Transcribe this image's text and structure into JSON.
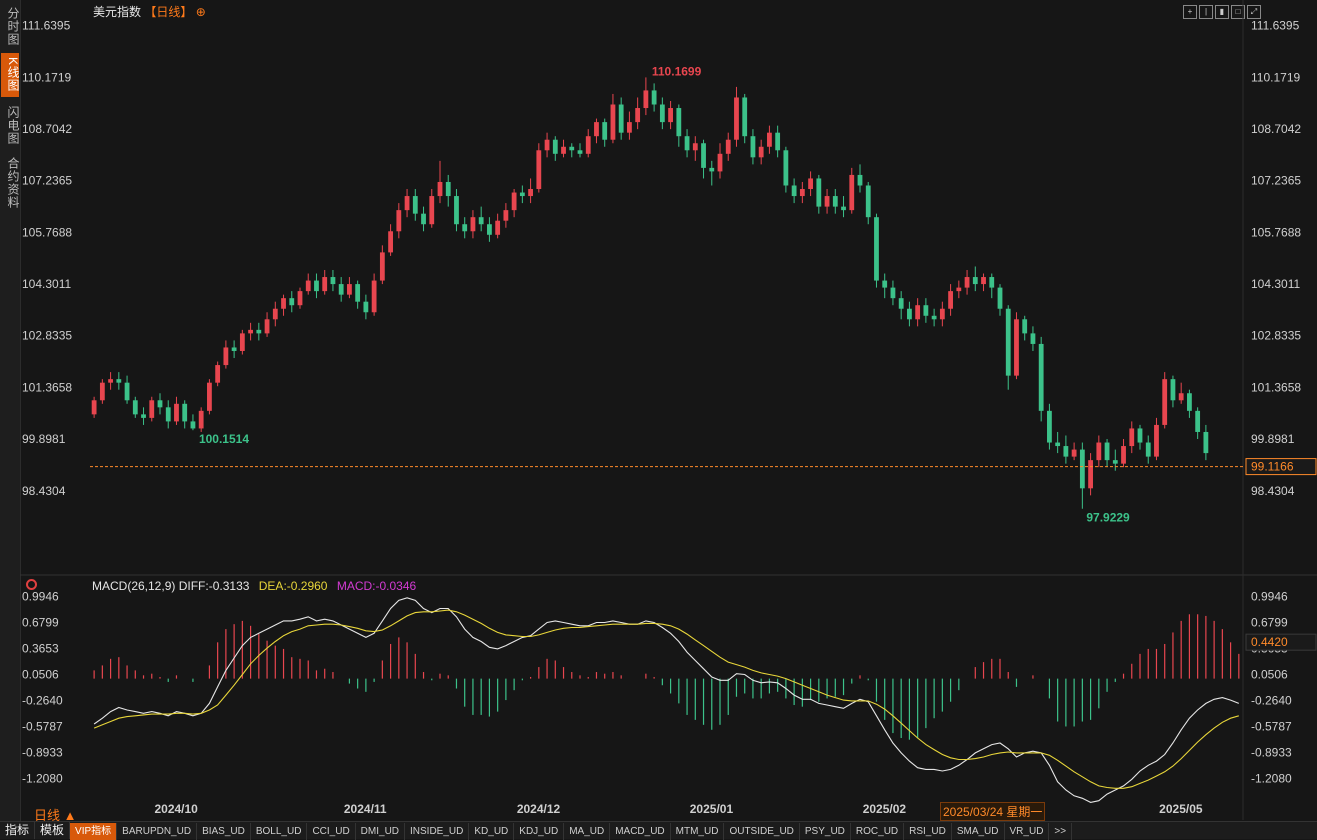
{
  "sidebar": {
    "tabs": [
      {
        "label": "分时图",
        "active": false
      },
      {
        "label": "K线图",
        "active": true
      },
      {
        "label": "闪电图",
        "active": false
      },
      {
        "label": "合约资料",
        "active": false
      }
    ]
  },
  "header": {
    "title": "美元指数",
    "period": "【日线】",
    "add_icon": "⊕",
    "toolbar_icons": [
      "crosshair-icon",
      "bars-icon",
      "candles-icon",
      "maximize-icon",
      "expand-icon"
    ]
  },
  "colors": {
    "up": "#e8464f",
    "down": "#3cc28a",
    "diff": "#e6e6e6",
    "dea": "#e8d63a",
    "macd": "#d33bd3",
    "accent": "#ff7a1a"
  },
  "price_axis": {
    "labels": [
      "111.6395",
      "110.1719",
      "108.7042",
      "107.2365",
      "105.7688",
      "104.3011",
      "102.8335",
      "101.3658",
      "99.8981",
      "98.4304"
    ]
  },
  "current_price": "99.1166",
  "annotations": {
    "high": "110.1699",
    "low_1": "100.1514",
    "low_2": "97.9229"
  },
  "macd": {
    "legend": {
      "name": "MACD(26,12,9)",
      "diff": "DIFF:-0.3133",
      "dea": "DEA:-0.2960",
      "macd": "MACD:-0.0346"
    },
    "axis_labels": [
      "0.9946",
      "0.6799",
      "0.3653",
      "0.0506",
      "-0.2640",
      "-0.5787",
      "-0.8933",
      "-1.2080"
    ],
    "cursor_value": "0.4420"
  },
  "date_axis": {
    "labels": [
      "2024/10",
      "2024/11",
      "2024/12",
      "2025/01",
      "2025/02",
      "2025/03",
      "2025/05"
    ],
    "cursor": "2025/03/24 星期一"
  },
  "period_select": "日线 ▲",
  "bottom_tabs": [
    "指标",
    "模板",
    "VIP指标",
    "BARUPDN_UD",
    "BIAS_UD",
    "BOLL_UD",
    "CCI_UD",
    "DMI_UD",
    "INSIDE_UD",
    "KD_UD",
    "KDJ_UD",
    "MA_UD",
    "MACD_UD",
    "MTM_UD",
    "OUTSIDE_UD",
    "PSY_UD",
    "ROC_UD",
    "RSI_UD",
    "SMA_UD",
    "VR_UD",
    ">>"
  ],
  "chart_data": {
    "type": "candlestick",
    "title": "美元指数",
    "ylim": [
      97.6,
      111.8
    ],
    "candles": [
      [
        100.6,
        101.0,
        101.1,
        100.5
      ],
      [
        101.0,
        101.5,
        101.6,
        100.9
      ],
      [
        101.5,
        101.6,
        101.8,
        101.3
      ],
      [
        101.6,
        101.5,
        101.8,
        101.3
      ],
      [
        101.5,
        101.0,
        101.7,
        100.9
      ],
      [
        101.0,
        100.6,
        101.1,
        100.5
      ],
      [
        100.6,
        100.5,
        100.8,
        100.3
      ],
      [
        100.5,
        101.0,
        101.1,
        100.4
      ],
      [
        101.0,
        100.8,
        101.2,
        100.6
      ],
      [
        100.8,
        100.4,
        101.0,
        100.2
      ],
      [
        100.4,
        100.9,
        101.1,
        100.3
      ],
      [
        100.9,
        100.4,
        101.0,
        100.2
      ],
      [
        100.4,
        100.2,
        100.6,
        100.15
      ],
      [
        100.2,
        100.7,
        100.8,
        100.1
      ],
      [
        100.7,
        101.5,
        101.6,
        100.6
      ],
      [
        101.5,
        102.0,
        102.1,
        101.4
      ],
      [
        102.0,
        102.5,
        102.7,
        101.9
      ],
      [
        102.5,
        102.4,
        102.7,
        102.2
      ],
      [
        102.4,
        102.9,
        103.0,
        102.3
      ],
      [
        102.9,
        103.0,
        103.2,
        102.7
      ],
      [
        103.0,
        102.9,
        103.2,
        102.7
      ],
      [
        102.9,
        103.3,
        103.5,
        102.8
      ],
      [
        103.3,
        103.6,
        103.8,
        103.1
      ],
      [
        103.6,
        103.9,
        104.0,
        103.4
      ],
      [
        103.9,
        103.7,
        104.1,
        103.5
      ],
      [
        103.7,
        104.1,
        104.2,
        103.6
      ],
      [
        104.1,
        104.4,
        104.6,
        104.0
      ],
      [
        104.4,
        104.1,
        104.6,
        103.9
      ],
      [
        104.1,
        104.5,
        104.7,
        104.0
      ],
      [
        104.5,
        104.3,
        104.7,
        104.1
      ],
      [
        104.3,
        104.0,
        104.5,
        103.8
      ],
      [
        104.0,
        104.3,
        104.5,
        103.9
      ],
      [
        104.3,
        103.8,
        104.4,
        103.6
      ],
      [
        103.8,
        103.5,
        104.0,
        103.3
      ],
      [
        103.5,
        104.4,
        104.6,
        103.4
      ],
      [
        104.4,
        105.2,
        105.4,
        104.3
      ],
      [
        105.2,
        105.8,
        106.0,
        105.1
      ],
      [
        105.8,
        106.4,
        106.6,
        105.6
      ],
      [
        106.4,
        106.8,
        107.0,
        106.2
      ],
      [
        106.8,
        106.3,
        107.0,
        106.1
      ],
      [
        106.3,
        106.0,
        106.5,
        105.8
      ],
      [
        106.0,
        106.8,
        107.0,
        105.9
      ],
      [
        106.8,
        107.2,
        107.8,
        106.6
      ],
      [
        107.2,
        106.8,
        107.4,
        106.5
      ],
      [
        106.8,
        106.0,
        107.0,
        105.8
      ],
      [
        106.0,
        105.8,
        106.2,
        105.6
      ],
      [
        105.8,
        106.2,
        106.4,
        105.6
      ],
      [
        106.2,
        106.0,
        106.5,
        105.8
      ],
      [
        106.0,
        105.7,
        106.2,
        105.5
      ],
      [
        105.7,
        106.1,
        106.3,
        105.6
      ],
      [
        106.1,
        106.4,
        106.6,
        105.9
      ],
      [
        106.4,
        106.9,
        107.0,
        106.2
      ],
      [
        106.9,
        106.8,
        107.1,
        106.6
      ],
      [
        106.8,
        107.0,
        107.3,
        106.6
      ],
      [
        107.0,
        108.1,
        108.3,
        106.9
      ],
      [
        108.1,
        108.4,
        108.6,
        107.9
      ],
      [
        108.4,
        108.0,
        108.5,
        107.8
      ],
      [
        108.0,
        108.2,
        108.4,
        107.9
      ],
      [
        108.2,
        108.1,
        108.3,
        107.9
      ],
      [
        108.1,
        108.0,
        108.3,
        107.9
      ],
      [
        108.0,
        108.5,
        108.7,
        107.9
      ],
      [
        108.5,
        108.9,
        109.0,
        108.3
      ],
      [
        108.9,
        108.4,
        109.0,
        108.2
      ],
      [
        108.4,
        109.4,
        109.7,
        108.3
      ],
      [
        109.4,
        108.6,
        109.6,
        108.4
      ],
      [
        108.6,
        108.9,
        109.2,
        108.4
      ],
      [
        108.9,
        109.3,
        109.6,
        108.7
      ],
      [
        109.3,
        109.8,
        110.17,
        109.1
      ],
      [
        109.8,
        109.4,
        110.0,
        109.2
      ],
      [
        109.4,
        108.9,
        109.6,
        108.7
      ],
      [
        108.9,
        109.3,
        109.5,
        108.7
      ],
      [
        109.3,
        108.5,
        109.4,
        108.2
      ],
      [
        108.5,
        108.1,
        108.7,
        107.9
      ],
      [
        108.1,
        108.3,
        108.5,
        107.8
      ],
      [
        108.3,
        107.6,
        108.4,
        107.3
      ],
      [
        107.6,
        107.5,
        107.8,
        107.1
      ],
      [
        107.5,
        108.0,
        108.3,
        107.3
      ],
      [
        108.0,
        108.4,
        108.6,
        107.8
      ],
      [
        108.4,
        109.6,
        109.9,
        108.2
      ],
      [
        109.6,
        108.5,
        109.7,
        108.3
      ],
      [
        108.5,
        107.9,
        108.7,
        107.7
      ],
      [
        107.9,
        108.2,
        108.4,
        107.7
      ],
      [
        108.2,
        108.6,
        108.8,
        108.0
      ],
      [
        108.6,
        108.1,
        108.8,
        107.9
      ],
      [
        108.1,
        107.1,
        108.2,
        106.9
      ],
      [
        107.1,
        106.8,
        107.3,
        106.6
      ],
      [
        106.8,
        107.0,
        107.2,
        106.6
      ],
      [
        107.0,
        107.3,
        107.5,
        106.8
      ],
      [
        107.3,
        106.5,
        107.4,
        106.3
      ],
      [
        106.5,
        106.8,
        107.0,
        106.3
      ],
      [
        106.8,
        106.5,
        107.0,
        106.3
      ],
      [
        106.5,
        106.4,
        106.8,
        106.2
      ],
      [
        106.4,
        107.4,
        107.6,
        106.3
      ],
      [
        107.4,
        107.1,
        107.7,
        106.9
      ],
      [
        107.1,
        106.2,
        107.2,
        106.0
      ],
      [
        106.2,
        104.4,
        106.3,
        104.2
      ],
      [
        104.4,
        104.2,
        104.6,
        103.9
      ],
      [
        104.2,
        103.9,
        104.4,
        103.7
      ],
      [
        103.9,
        103.6,
        104.1,
        103.3
      ],
      [
        103.6,
        103.3,
        103.8,
        103.1
      ],
      [
        103.3,
        103.7,
        103.9,
        103.1
      ],
      [
        103.7,
        103.4,
        103.9,
        103.2
      ],
      [
        103.4,
        103.3,
        103.6,
        103.1
      ],
      [
        103.3,
        103.6,
        103.8,
        103.1
      ],
      [
        103.6,
        104.1,
        104.3,
        103.4
      ],
      [
        104.1,
        104.2,
        104.4,
        103.9
      ],
      [
        104.2,
        104.5,
        104.7,
        104.0
      ],
      [
        104.5,
        104.3,
        104.8,
        104.1
      ],
      [
        104.3,
        104.5,
        104.6,
        104.1
      ],
      [
        104.5,
        104.2,
        104.6,
        103.9
      ],
      [
        104.2,
        103.6,
        104.3,
        103.4
      ],
      [
        103.6,
        101.7,
        103.7,
        101.3
      ],
      [
        101.7,
        103.3,
        103.5,
        101.6
      ],
      [
        103.3,
        102.9,
        103.4,
        102.7
      ],
      [
        102.9,
        102.6,
        103.1,
        102.4
      ],
      [
        102.6,
        100.7,
        102.8,
        100.4
      ],
      [
        100.7,
        99.8,
        100.9,
        99.6
      ],
      [
        99.8,
        99.7,
        100.1,
        99.5
      ],
      [
        99.7,
        99.4,
        100.0,
        99.2
      ],
      [
        99.4,
        99.6,
        99.8,
        99.3
      ],
      [
        99.6,
        98.5,
        99.8,
        97.92
      ],
      [
        98.5,
        99.3,
        99.5,
        98.3
      ],
      [
        99.3,
        99.8,
        100.0,
        99.1
      ],
      [
        99.8,
        99.3,
        99.9,
        99.1
      ],
      [
        99.3,
        99.2,
        99.6,
        99.0
      ],
      [
        99.2,
        99.7,
        99.9,
        99.1
      ],
      [
        99.7,
        100.2,
        100.4,
        99.5
      ],
      [
        100.2,
        99.8,
        100.3,
        99.6
      ],
      [
        99.8,
        99.4,
        100.0,
        99.2
      ],
      [
        99.4,
        100.3,
        100.5,
        99.3
      ],
      [
        100.3,
        101.6,
        101.8,
        100.2
      ],
      [
        101.6,
        101.0,
        101.7,
        100.8
      ],
      [
        101.0,
        101.2,
        101.5,
        100.9
      ],
      [
        101.2,
        100.7,
        101.3,
        100.5
      ],
      [
        100.7,
        100.1,
        100.8,
        99.9
      ],
      [
        100.1,
        99.5,
        100.3,
        99.3
      ]
    ],
    "diff": [
      -0.55,
      -0.48,
      -0.4,
      -0.35,
      -0.38,
      -0.4,
      -0.42,
      -0.4,
      -0.42,
      -0.45,
      -0.4,
      -0.42,
      -0.45,
      -0.42,
      -0.3,
      -0.1,
      0.1,
      0.25,
      0.4,
      0.5,
      0.55,
      0.6,
      0.65,
      0.7,
      0.7,
      0.72,
      0.75,
      0.7,
      0.72,
      0.7,
      0.65,
      0.6,
      0.55,
      0.5,
      0.55,
      0.7,
      0.85,
      0.95,
      0.98,
      0.95,
      0.85,
      0.8,
      0.85,
      0.85,
      0.75,
      0.6,
      0.5,
      0.45,
      0.38,
      0.36,
      0.4,
      0.45,
      0.5,
      0.52,
      0.6,
      0.68,
      0.7,
      0.68,
      0.66,
      0.64,
      0.64,
      0.68,
      0.68,
      0.7,
      0.68,
      0.66,
      0.66,
      0.7,
      0.68,
      0.62,
      0.55,
      0.45,
      0.32,
      0.22,
      0.12,
      0.02,
      -0.02,
      -0.02,
      0.06,
      0.05,
      -0.02,
      -0.05,
      -0.04,
      -0.05,
      -0.12,
      -0.2,
      -0.25,
      -0.25,
      -0.3,
      -0.32,
      -0.34,
      -0.36,
      -0.3,
      -0.25,
      -0.28,
      -0.45,
      -0.62,
      -0.78,
      -0.9,
      -1.0,
      -1.08,
      -1.1,
      -1.1,
      -1.12,
      -1.1,
      -1.05,
      -0.98,
      -0.9,
      -0.85,
      -0.8,
      -0.78,
      -0.85,
      -0.95,
      -0.9,
      -0.88,
      -0.9,
      -1.05,
      -1.25,
      -1.35,
      -1.42,
      -1.45,
      -1.5,
      -1.48,
      -1.4,
      -1.35,
      -1.3,
      -1.22,
      -1.12,
      -1.05,
      -1.0,
      -0.92,
      -0.78,
      -0.62,
      -0.48,
      -0.38,
      -0.3,
      -0.25,
      -0.23,
      -0.26,
      -0.3
    ],
    "dea": [
      -0.6,
      -0.56,
      -0.52,
      -0.48,
      -0.46,
      -0.45,
      -0.44,
      -0.43,
      -0.43,
      -0.43,
      -0.42,
      -0.42,
      -0.43,
      -0.42,
      -0.38,
      -0.32,
      -0.2,
      -0.08,
      0.05,
      0.18,
      0.28,
      0.37,
      0.45,
      0.52,
      0.57,
      0.6,
      0.64,
      0.65,
      0.66,
      0.66,
      0.65,
      0.63,
      0.61,
      0.58,
      0.57,
      0.59,
      0.64,
      0.7,
      0.76,
      0.8,
      0.81,
      0.81,
      0.82,
      0.83,
      0.81,
      0.77,
      0.72,
      0.67,
      0.61,
      0.56,
      0.53,
      0.52,
      0.51,
      0.51,
      0.53,
      0.56,
      0.59,
      0.61,
      0.62,
      0.62,
      0.63,
      0.64,
      0.65,
      0.66,
      0.66,
      0.66,
      0.66,
      0.67,
      0.67,
      0.66,
      0.64,
      0.6,
      0.54,
      0.47,
      0.4,
      0.33,
      0.26,
      0.2,
      0.17,
      0.14,
      0.1,
      0.07,
      0.05,
      0.03,
      0.0,
      -0.04,
      -0.08,
      -0.12,
      -0.16,
      -0.2,
      -0.23,
      -0.26,
      -0.27,
      -0.27,
      -0.27,
      -0.31,
      -0.37,
      -0.45,
      -0.54,
      -0.63,
      -0.72,
      -0.8,
      -0.86,
      -0.92,
      -0.96,
      -0.98,
      -0.98,
      -0.97,
      -0.95,
      -0.92,
      -0.9,
      -0.89,
      -0.9,
      -0.9,
      -0.9,
      -0.9,
      -0.93,
      -0.99,
      -1.06,
      -1.13,
      -1.19,
      -1.25,
      -1.3,
      -1.32,
      -1.33,
      -1.33,
      -1.31,
      -1.27,
      -1.23,
      -1.18,
      -1.13,
      -1.06,
      -0.97,
      -0.87,
      -0.77,
      -0.68,
      -0.6,
      -0.53,
      -0.48,
      -0.45
    ],
    "macd_ylim": [
      -1.35,
      1.05
    ]
  }
}
